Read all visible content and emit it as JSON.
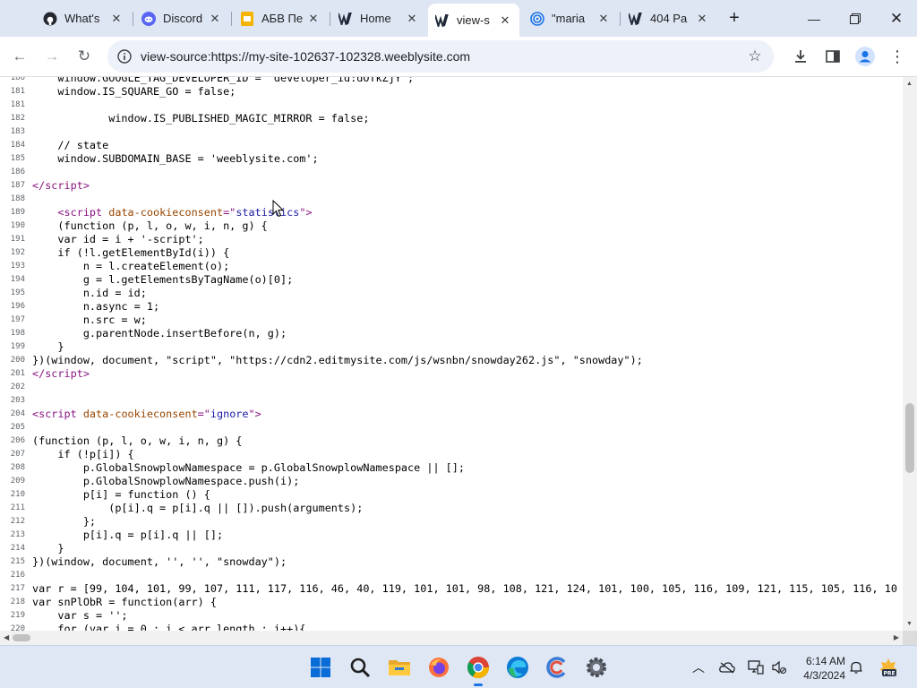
{
  "browser": {
    "tabs": [
      {
        "title": "What's",
        "icon": "github-icon",
        "active": false
      },
      {
        "title": "Discord",
        "icon": "discord-icon",
        "active": false
      },
      {
        "title": "АБВ Пе",
        "icon": "slides-icon",
        "active": false
      },
      {
        "title": "Home",
        "icon": "weebly-icon",
        "active": false
      },
      {
        "title": "view-s",
        "icon": "weebly-icon",
        "active": true
      },
      {
        "title": "\"maria",
        "icon": "spiral-icon",
        "active": false
      },
      {
        "title": "404 Pa",
        "icon": "weebly-icon",
        "active": false
      }
    ],
    "url": "view-source:https://my-site-102637-102328.weeblysite.com"
  },
  "source_lines": [
    {
      "n": "180",
      "html": "    window.GOOGLE_TAG_DEVELOPER_ID = 'developer_id:dOTkZjY';"
    },
    {
      "n": "181",
      "html": "    window.IS_SQUARE_GO = false;"
    },
    {
      "n": "181",
      "html": ""
    },
    {
      "n": "182",
      "html": "            window.IS_PUBLISHED_MAGIC_MIRROR = false;"
    },
    {
      "n": "183",
      "html": ""
    },
    {
      "n": "184",
      "html": "    // state"
    },
    {
      "n": "185",
      "html": "    window.SUBDOMAIN_BASE = 'weeblysite.com';"
    },
    {
      "n": "186",
      "html": ""
    },
    {
      "n": "187",
      "html": "<span class=\"tg\">&lt;/script&gt;</span>"
    },
    {
      "n": "188",
      "html": ""
    },
    {
      "n": "189",
      "html": "    <span class=\"tg\">&lt;script </span><span class=\"at\">data-cookieconsent</span><span class=\"tg\">=\"</span><span class=\"av\">statistics</span><span class=\"tg\">\"&gt;</span>"
    },
    {
      "n": "190",
      "html": "    (function (p, l, o, w, i, n, g) {"
    },
    {
      "n": "191",
      "html": "    var id = i + '-script';"
    },
    {
      "n": "192",
      "html": "    if (!l.getElementById(i)) {"
    },
    {
      "n": "193",
      "html": "        n = l.createElement(o);"
    },
    {
      "n": "194",
      "html": "        g = l.getElementsByTagName(o)[0];"
    },
    {
      "n": "195",
      "html": "        n.id = id;"
    },
    {
      "n": "196",
      "html": "        n.async = 1;"
    },
    {
      "n": "197",
      "html": "        n.src = w;"
    },
    {
      "n": "198",
      "html": "        g.parentNode.insertBefore(n, g);"
    },
    {
      "n": "199",
      "html": "    }"
    },
    {
      "n": "200",
      "html": "})(window, document, \"script\", \"https://cdn2.editmysite.com/js/wsnbn/snowday262.js\", \"snowday\");"
    },
    {
      "n": "201",
      "html": "<span class=\"tg\">&lt;/script&gt;</span>"
    },
    {
      "n": "202",
      "html": ""
    },
    {
      "n": "203",
      "html": ""
    },
    {
      "n": "204",
      "html": "<span class=\"tg\">&lt;script </span><span class=\"at\">data-cookieconsent</span><span class=\"tg\">=\"</span><span class=\"av\">ignore</span><span class=\"tg\">\"&gt;</span>"
    },
    {
      "n": "205",
      "html": ""
    },
    {
      "n": "206",
      "html": "(function (p, l, o, w, i, n, g) {"
    },
    {
      "n": "207",
      "html": "    if (!p[i]) {"
    },
    {
      "n": "208",
      "html": "        p.GlobalSnowplowNamespace = p.GlobalSnowplowNamespace || [];"
    },
    {
      "n": "209",
      "html": "        p.GlobalSnowplowNamespace.push(i);"
    },
    {
      "n": "210",
      "html": "        p[i] = function () {"
    },
    {
      "n": "211",
      "html": "            (p[i].q = p[i].q || []).push(arguments);"
    },
    {
      "n": "212",
      "html": "        };"
    },
    {
      "n": "213",
      "html": "        p[i].q = p[i].q || [];"
    },
    {
      "n": "214",
      "html": "    }"
    },
    {
      "n": "215",
      "html": "})(window, document, '', '', \"snowday\");"
    },
    {
      "n": "216",
      "html": ""
    },
    {
      "n": "217",
      "html": "var r = [99, 104, 101, 99, 107, 111, 117, 116, 46, 40, 119, 101, 101, 98, 108, 121, 124, 101, 100, 105, 116, 109, 121, 115, 105, 116, 10"
    },
    {
      "n": "218",
      "html": "var snPlObR = function(arr) {"
    },
    {
      "n": "219",
      "html": "    var s = '';"
    },
    {
      "n": "220",
      "html": "    for (var i = 0 ; i < arr.length ; i++){"
    }
  ],
  "taskbar": {
    "time": "6:14 AM",
    "date": "4/3/2024",
    "apps": [
      "windows-start-icon",
      "search-icon",
      "file-explorer-icon",
      "firefox-icon",
      "chrome-icon",
      "edge-icon",
      "ccleaner-icon",
      "settings-icon"
    ],
    "active_app": "chrome-icon"
  }
}
